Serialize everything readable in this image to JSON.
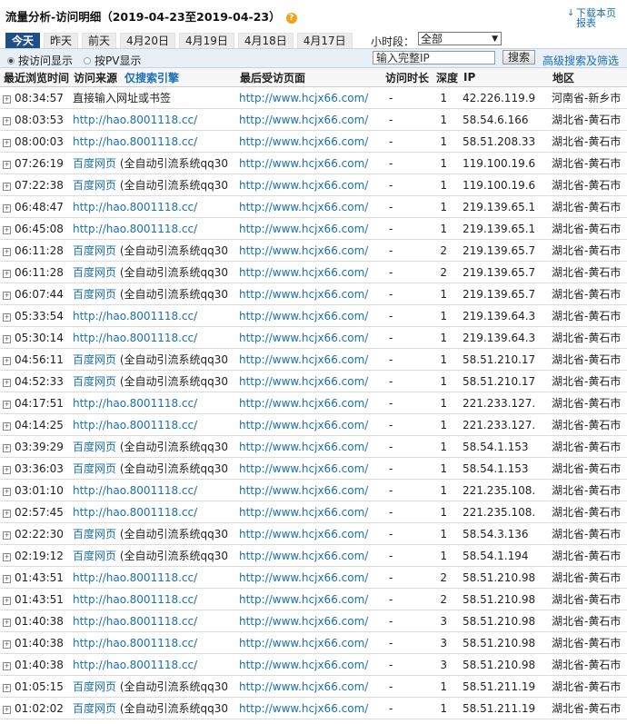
{
  "header": {
    "title": "流量分析-访问明细（2019-04-23至2019-04-23）",
    "help_icon": "?",
    "download_icon": "↓",
    "download_label": "下载本页报表"
  },
  "tabs": [
    "今天",
    "昨天",
    "前天",
    "4月20日",
    "4月19日",
    "4月18日",
    "4月17日"
  ],
  "active_tab": "今天",
  "hour_label": "小时段：",
  "hour_select": "全部",
  "filter": {
    "radio_visit": "按访问显示",
    "radio_pv": "按PV显示",
    "ip_placeholder": "输入完整IP",
    "search_button": "搜索",
    "advanced_link": "高级搜索及筛选"
  },
  "table": {
    "headers": [
      "最近浏览时间",
      "访问来源",
      "仅搜索引擎",
      "最后受访页面",
      "访问时长",
      "深度",
      "IP",
      "地区"
    ],
    "rows": [
      {
        "time": "08:34:57",
        "src": "直接输入网址或书签",
        "src_kw": "",
        "page": "http://www.hcjx66.com/",
        "dur": "-",
        "depth": "1",
        "ip": "42.226.119.9",
        "region": "河南省-新乡市"
      },
      {
        "time": "08:03:53",
        "src": "http://hao.8001118.cc/",
        "src_kw": "",
        "page": "http://www.hcjx66.com/",
        "dur": "-",
        "depth": "1",
        "ip": "58.54.6.166",
        "region": "湖北省-黄石市"
      },
      {
        "time": "08:00:03",
        "src": "http://hao.8001118.cc/",
        "src_kw": "",
        "page": "http://www.hcjx66.com/",
        "dur": "-",
        "depth": "1",
        "ip": "58.51.208.33",
        "region": "湖北省-黄石市"
      },
      {
        "time": "07:26:19",
        "src": "百度网页",
        "src_kw": "(全自动引流系统qq30",
        "page": "http://www.hcjx66.com/",
        "dur": "-",
        "depth": "1",
        "ip": "119.100.19.6",
        "region": "湖北省-黄石市"
      },
      {
        "time": "07:22:38",
        "src": "百度网页",
        "src_kw": "(全自动引流系统qq30",
        "page": "http://www.hcjx66.com/",
        "dur": "-",
        "depth": "1",
        "ip": "119.100.19.6",
        "region": "湖北省-黄石市"
      },
      {
        "time": "06:48:47",
        "src": "http://hao.8001118.cc/",
        "src_kw": "",
        "page": "http://www.hcjx66.com/",
        "dur": "-",
        "depth": "1",
        "ip": "219.139.65.1",
        "region": "湖北省-黄石市"
      },
      {
        "time": "06:45:08",
        "src": "http://hao.8001118.cc/",
        "src_kw": "",
        "page": "http://www.hcjx66.com/",
        "dur": "-",
        "depth": "1",
        "ip": "219.139.65.1",
        "region": "湖北省-黄石市"
      },
      {
        "time": "06:11:28",
        "src": "百度网页",
        "src_kw": "(全自动引流系统qq30",
        "page": "http://www.hcjx66.com/",
        "dur": "-",
        "depth": "2",
        "ip": "219.139.65.7",
        "region": "湖北省-黄石市"
      },
      {
        "time": "06:11:28",
        "src": "百度网页",
        "src_kw": "(全自动引流系统qq30",
        "page": "http://www.hcjx66.com/",
        "dur": "-",
        "depth": "2",
        "ip": "219.139.65.7",
        "region": "湖北省-黄石市"
      },
      {
        "time": "06:07:44",
        "src": "百度网页",
        "src_kw": "(全自动引流系统qq30",
        "page": "http://www.hcjx66.com/",
        "dur": "-",
        "depth": "1",
        "ip": "219.139.65.7",
        "region": "湖北省-黄石市"
      },
      {
        "time": "05:33:54",
        "src": "http://hao.8001118.cc/",
        "src_kw": "",
        "page": "http://www.hcjx66.com/",
        "dur": "-",
        "depth": "1",
        "ip": "219.139.64.3",
        "region": "湖北省-黄石市"
      },
      {
        "time": "05:30:14",
        "src": "http://hao.8001118.cc/",
        "src_kw": "",
        "page": "http://www.hcjx66.com/",
        "dur": "-",
        "depth": "1",
        "ip": "219.139.64.3",
        "region": "湖北省-黄石市"
      },
      {
        "time": "04:56:11",
        "src": "百度网页",
        "src_kw": "(全自动引流系统qq30",
        "page": "http://www.hcjx66.com/",
        "dur": "-",
        "depth": "1",
        "ip": "58.51.210.17",
        "region": "湖北省-黄石市"
      },
      {
        "time": "04:52:33",
        "src": "百度网页",
        "src_kw": "(全自动引流系统qq30",
        "page": "http://www.hcjx66.com/",
        "dur": "-",
        "depth": "1",
        "ip": "58.51.210.17",
        "region": "湖北省-黄石市"
      },
      {
        "time": "04:17:51",
        "src": "http://hao.8001118.cc/",
        "src_kw": "",
        "page": "http://www.hcjx66.com/",
        "dur": "-",
        "depth": "1",
        "ip": "221.233.127.",
        "region": "湖北省-黄石市"
      },
      {
        "time": "04:14:25",
        "src": "http://hao.8001118.cc/",
        "src_kw": "",
        "page": "http://www.hcjx66.com/",
        "dur": "-",
        "depth": "1",
        "ip": "221.233.127.",
        "region": "湖北省-黄石市"
      },
      {
        "time": "03:39:29",
        "src": "百度网页",
        "src_kw": "(全自动引流系统qq30",
        "page": "http://www.hcjx66.com/",
        "dur": "-",
        "depth": "1",
        "ip": "58.54.1.153",
        "region": "湖北省-黄石市"
      },
      {
        "time": "03:36:03",
        "src": "百度网页",
        "src_kw": "(全自动引流系统qq30",
        "page": "http://www.hcjx66.com/",
        "dur": "-",
        "depth": "1",
        "ip": "58.54.1.153",
        "region": "湖北省-黄石市"
      },
      {
        "time": "03:01:10",
        "src": "http://hao.8001118.cc/",
        "src_kw": "",
        "page": "http://www.hcjx66.com/",
        "dur": "-",
        "depth": "1",
        "ip": "221.235.108.",
        "region": "湖北省-黄石市"
      },
      {
        "time": "02:57:45",
        "src": "http://hao.8001118.cc/",
        "src_kw": "",
        "page": "http://www.hcjx66.com/",
        "dur": "-",
        "depth": "1",
        "ip": "221.235.108.",
        "region": "湖北省-黄石市"
      },
      {
        "time": "02:22:30",
        "src": "百度网页",
        "src_kw": "(全自动引流系统qq30",
        "page": "http://www.hcjx66.com/",
        "dur": "-",
        "depth": "1",
        "ip": "58.54.3.136",
        "region": "湖北省-黄石市"
      },
      {
        "time": "02:19:12",
        "src": "百度网页",
        "src_kw": "(全自动引流系统qq30",
        "page": "http://www.hcjx66.com/",
        "dur": "-",
        "depth": "1",
        "ip": "58.54.1.194",
        "region": "湖北省-黄石市"
      },
      {
        "time": "01:43:51",
        "src": "http://hao.8001118.cc/",
        "src_kw": "",
        "page": "http://www.hcjx66.com/",
        "dur": "-",
        "depth": "2",
        "ip": "58.51.210.98",
        "region": "湖北省-黄石市"
      },
      {
        "time": "01:43:51",
        "src": "http://hao.8001118.cc/",
        "src_kw": "",
        "page": "http://www.hcjx66.com/",
        "dur": "-",
        "depth": "2",
        "ip": "58.51.210.98",
        "region": "湖北省-黄石市"
      },
      {
        "time": "01:40:38",
        "src": "http://hao.8001118.cc/",
        "src_kw": "",
        "page": "http://www.hcjx66.com/",
        "dur": "-",
        "depth": "3",
        "ip": "58.51.210.98",
        "region": "湖北省-黄石市"
      },
      {
        "time": "01:40:38",
        "src": "http://hao.8001118.cc/",
        "src_kw": "",
        "page": "http://www.hcjx66.com/",
        "dur": "-",
        "depth": "3",
        "ip": "58.51.210.98",
        "region": "湖北省-黄石市"
      },
      {
        "time": "01:40:38",
        "src": "http://hao.8001118.cc/",
        "src_kw": "",
        "page": "http://www.hcjx66.com/",
        "dur": "-",
        "depth": "3",
        "ip": "58.51.210.98",
        "region": "湖北省-黄石市"
      },
      {
        "time": "01:05:15",
        "src": "百度网页",
        "src_kw": "(全自动引流系统qq30",
        "page": "http://www.hcjx66.com/",
        "dur": "-",
        "depth": "1",
        "ip": "58.51.211.19",
        "region": "湖北省-黄石市"
      },
      {
        "time": "01:02:02",
        "src": "百度网页",
        "src_kw": "(全自动引流系统qq30",
        "page": "http://www.hcjx66.com/",
        "dur": "-",
        "depth": "1",
        "ip": "58.51.211.19",
        "region": "湖北省-黄石市"
      }
    ]
  },
  "colors": {
    "link": "#1a6fb5",
    "active_tab_bg": "#1f4f86",
    "help_icon": "#f0a21c",
    "filterbar_bg": "#e9eff6"
  }
}
